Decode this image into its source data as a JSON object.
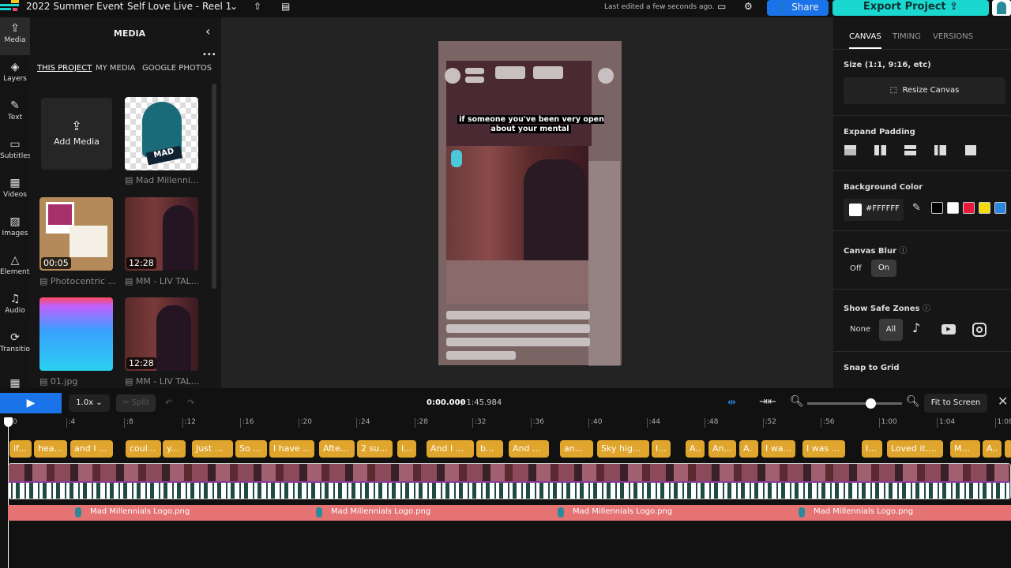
{
  "topbar": {
    "project": "2022 Summer Event",
    "sep": "›",
    "title": "Self Love Live - Reel 1",
    "last_edited": "Last edited a few seconds ago.",
    "share": "Share",
    "export": "Export Project"
  },
  "rail": [
    {
      "label": "Media",
      "icon": "upload-icon"
    },
    {
      "label": "Layers",
      "icon": "layers-icon"
    },
    {
      "label": "Text",
      "icon": "text-icon"
    },
    {
      "label": "Subtitles",
      "icon": "subtitles-icon"
    },
    {
      "label": "Videos",
      "icon": "film-icon"
    },
    {
      "label": "Images",
      "icon": "image-icon"
    },
    {
      "label": "Elements",
      "icon": "shapes-icon"
    },
    {
      "label": "Audio",
      "icon": "music-icon"
    },
    {
      "label": "Transitions",
      "icon": "loop-icon"
    }
  ],
  "media": {
    "title": "MEDIA",
    "tabs": [
      "THIS PROJECT",
      "MY MEDIA",
      "GOOGLE PHOTOS"
    ],
    "add": "Add Media",
    "items": [
      {
        "name": "Mad Millenni...",
        "duration": ""
      },
      {
        "name": "Photocentric ...",
        "duration": "00:05"
      },
      {
        "name": "MM - LIV TAL...",
        "duration": "12:28"
      },
      {
        "name": "01.jpg",
        "duration": ""
      },
      {
        "name": "MM - LIV TAL...",
        "duration": "12:28"
      }
    ]
  },
  "preview": {
    "caption": "if someone you've been very open about your mental"
  },
  "right": {
    "tabs": [
      "CANVAS",
      "TIMING",
      "VERSIONS"
    ],
    "size_label": "Size (1:1, 9:16, etc)",
    "resize": "Resize Canvas",
    "padding_label": "Expand Padding",
    "bg_label": "Background Color",
    "bg_value": "#FFFFFF",
    "swatches": [
      "#000000",
      "#FFFFFF",
      "#E8193C",
      "#F5D90A",
      "#2B86E0"
    ],
    "blur_label": "Canvas Blur",
    "blur_off": "Off",
    "blur_on": "On",
    "safe_label": "Show Safe Zones",
    "safe_none": "None",
    "safe_all": "All",
    "snap_label": "Snap to Grid"
  },
  "timeline": {
    "speed": "1.0x",
    "split": "Split",
    "current": "0:00.000",
    "total": "/ 1:45.984",
    "fit": "Fit to Screen",
    "zoom_level": 0.67,
    "ticks": [
      ":0",
      ":4",
      ":8",
      ":12",
      ":16",
      ":20",
      ":24",
      ":28",
      ":32",
      ":36",
      ":40",
      ":44",
      ":48",
      ":52",
      ":56",
      "1:00",
      "1:04",
      "1:08"
    ],
    "subtitles": [
      "if...",
      "hea...",
      "and I ...",
      "coul...",
      "y...",
      "Just ...",
      "So ...",
      "I have ...",
      "Afte...",
      "2 su...",
      "I...",
      "And I ...",
      "b...",
      "And ...",
      "an...",
      "Sky hig...",
      "I...",
      "A..",
      "An...",
      "A.",
      "I wa...",
      "I was ...",
      "I...",
      "Loved it....",
      "M...",
      "A..",
      ""
    ],
    "logo_label": "Mad Millennials Logo.png"
  },
  "colors": {
    "accent": "#1ad8d0",
    "share": "#1a73e8",
    "subtitle": "#e0a52c",
    "logo_track": "#e57373"
  }
}
